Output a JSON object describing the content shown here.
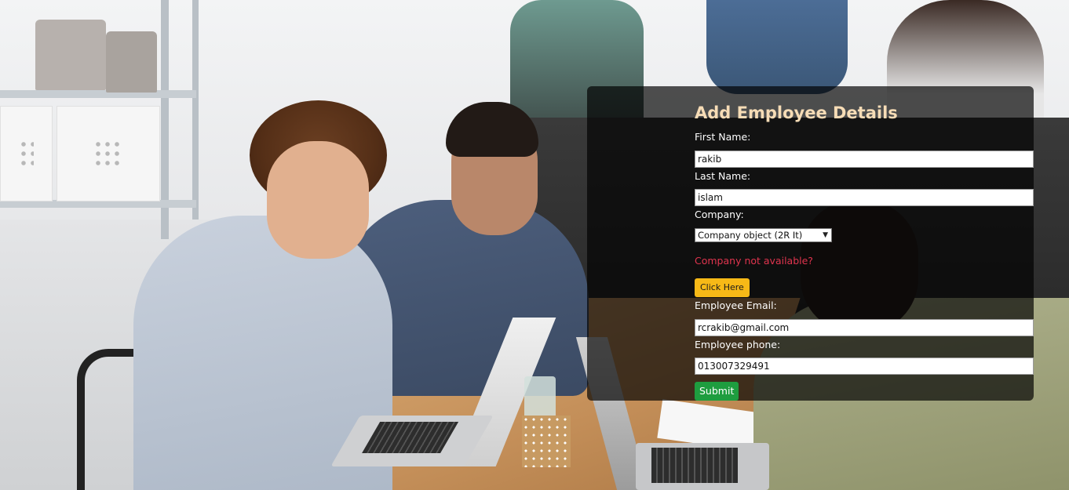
{
  "form": {
    "title": "Add Employee Details",
    "first_name": {
      "label": "First Name:",
      "value": "rakib"
    },
    "last_name": {
      "label": "Last Name:",
      "value": "islam"
    },
    "company": {
      "label": "Company:",
      "selected": "Company object (2R It)"
    },
    "company_missing_text": "Company not available?",
    "click_here_label": "Click Here",
    "email": {
      "label": "Employee Email:",
      "value": "rcrakib@gmail.com"
    },
    "phone": {
      "label": "Employee phone:",
      "value": "013007329491"
    },
    "submit_label": "Submit"
  },
  "colors": {
    "title": "#f6dcb6",
    "warning_text": "#e0344e",
    "click_here_button": "#f7b917",
    "submit_button": "#1e9d3f",
    "panel_overlay": "rgba(0,0,0,0.68)"
  },
  "icons": {
    "select_arrow": "chevron-down-icon"
  }
}
